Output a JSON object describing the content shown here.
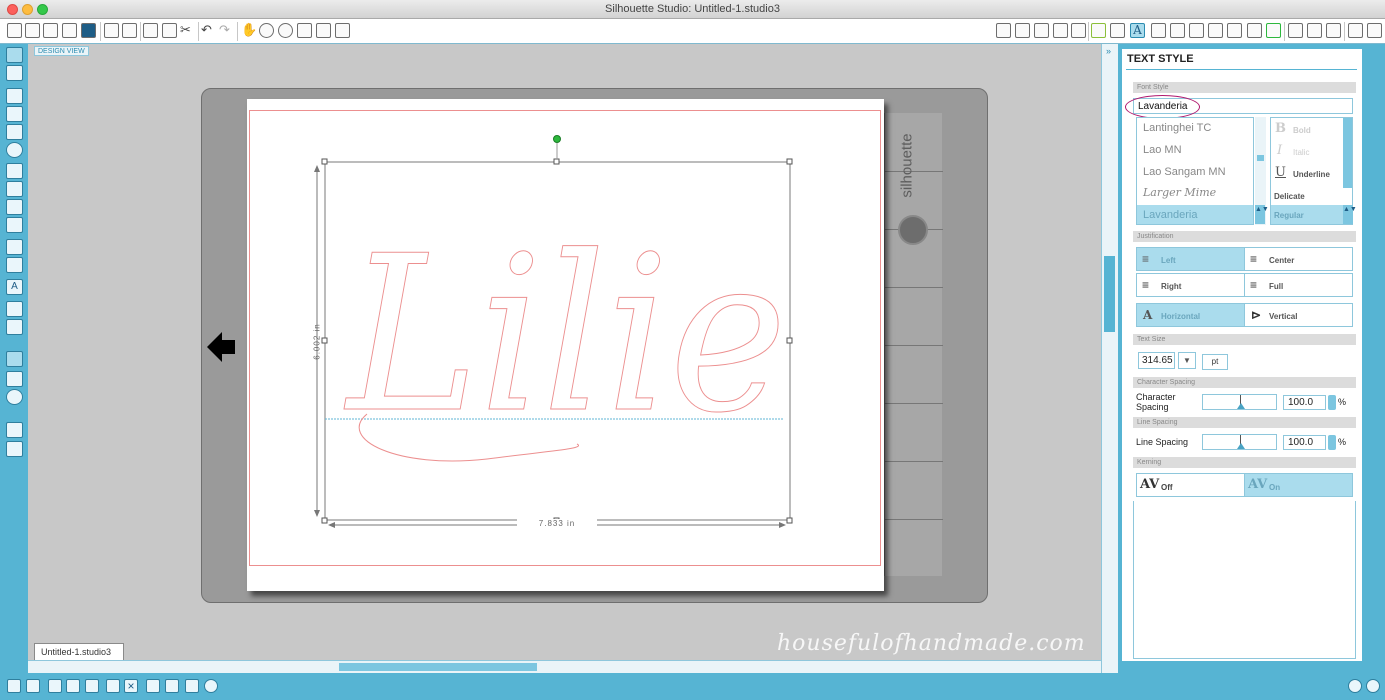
{
  "window": {
    "title": "Silhouette Studio: Untitled-1.studio3"
  },
  "design_view_label": "DESIGN VIEW",
  "doc_tab": {
    "label": "Untitled-1.studio3"
  },
  "canvas": {
    "text": "Lilie",
    "height_dim": "6.002 in",
    "width_dim": "7.833 in",
    "mat_brand": "silhouette"
  },
  "watermark": "housefulofhandmade.com",
  "panel": {
    "title": "TEXT STYLE",
    "font_style_section": "Font Style",
    "font_input": "Lavanderia",
    "font_list": [
      "Lantinghei TC",
      "Lao MN",
      "Lao Sangam MN",
      "Larger Mime",
      "Lavanderia"
    ],
    "font_selected_index": 4,
    "style_list": [
      "Bold",
      "Italic",
      "Underline",
      "Delicate",
      "Regular"
    ],
    "justification_section": "Justification",
    "justify": {
      "left": "Left",
      "center": "Center",
      "right": "Right",
      "full": "Full",
      "horizontal": "Horizontal",
      "vertical": "Vertical"
    },
    "text_size_section": "Text Size",
    "text_size_value": "314.65",
    "text_size_unit": "pt",
    "char_spacing_section": "Character Spacing",
    "char_spacing_label": "Character Spacing",
    "char_spacing_value": "100.0",
    "line_spacing_section": "Line Spacing",
    "line_spacing_label": "Line Spacing",
    "line_spacing_value": "100.0",
    "percent": "%",
    "kerning_section": "Kerning",
    "kerning_off": "Off",
    "kerning_on": "On",
    "kerning_av": "AV"
  },
  "colors": {
    "accent": "#56b4d3",
    "cut_line": "#ec8f8f",
    "selected": "#aadced",
    "handle_rotate": "#2db83d"
  }
}
